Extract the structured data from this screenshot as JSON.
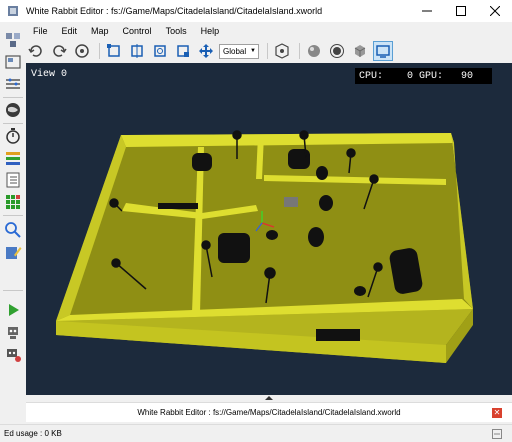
{
  "window": {
    "title": "White Rabbit Editor : fs://Game/Maps/CitadelaIsland/CitadelaIsland.xworld",
    "controls": [
      "minimize-icon",
      "maximize-icon",
      "close-icon"
    ]
  },
  "menu": {
    "items": [
      "File",
      "Edit",
      "Map",
      "Control",
      "Tools",
      "Help"
    ]
  },
  "toolbar": {
    "coordinate_space": "Global",
    "buttons": [
      "undo-icon",
      "redo-icon",
      "camera-icon",
      "select-icon",
      "translate-icon",
      "rotate-icon",
      "scale-icon",
      "move-icon",
      "view-icon",
      "sphere-icon",
      "light-icon",
      "cube-icon",
      "viewport-icon"
    ]
  },
  "left_tools": {
    "buttons": [
      "objects-icon",
      "assets-icon",
      "properties-icon",
      "globe-icon",
      "stopwatch-icon",
      "layers-icon",
      "checklist-icon",
      "grid-icon",
      "search-icon",
      "edit-icon",
      "play-icon",
      "robot-icon",
      "robot-settings-icon"
    ]
  },
  "viewport": {
    "label": "View 0",
    "perf": "CPU:    0 GPU:   90"
  },
  "console": {
    "text": "White Rabbit Editor : fs://Game/Maps/CitadelaIsland/CitadelaIsland.xworld"
  },
  "status": {
    "text": "Ed usage : 0 KB"
  },
  "colors": {
    "viewport_bg": "#1c2a3c",
    "floor": "#8f8f14",
    "wall_top": "#dede30",
    "wall_side": "#b4b41e",
    "accent": "#5a9fd4"
  }
}
